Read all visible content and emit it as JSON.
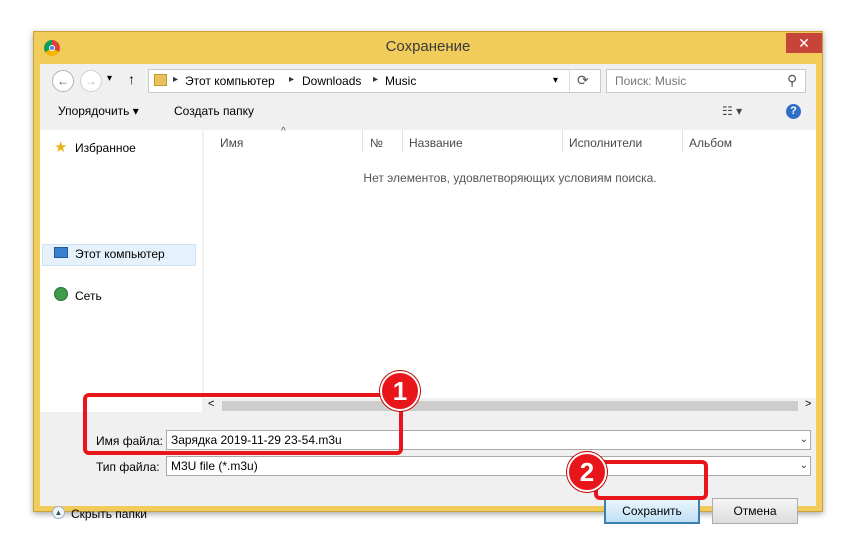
{
  "window": {
    "title": "Сохранение",
    "close_glyph": "✕"
  },
  "address": {
    "back_glyph": "←",
    "forward_glyph": "→",
    "dropdown_glyph": "▾",
    "up_glyph": "↑",
    "crumbs": [
      "Этот компьютер",
      "Downloads",
      "Music"
    ],
    "sep_glyph": "▸",
    "refresh_glyph": "⟳"
  },
  "search": {
    "placeholder": "Поиск: Music",
    "icon_glyph": "⚲"
  },
  "toolbar": {
    "organize": "Упорядочить ▾",
    "new_folder": "Создать папку",
    "view_glyph": "☷ ▾",
    "help_glyph": "?"
  },
  "nav": {
    "favorites": "Избранное",
    "computer": "Этот компьютер",
    "network": "Сеть"
  },
  "list": {
    "columns": [
      "Имя",
      "№",
      "Название",
      "Исполнители",
      "Альбом"
    ],
    "empty_message": "Нет элементов, удовлетворяющих условиям поиска.",
    "sort_glyph": "^"
  },
  "scroll": {
    "left_glyph": "<",
    "right_glyph": ">"
  },
  "form": {
    "filename_label": "Имя файла:",
    "filename_value": "Зарядка 2019-11-29 23-54.m3u",
    "filetype_label": "Тип файла:",
    "filetype_value": "M3U file (*.m3u)",
    "dd_glyph": "⌄"
  },
  "footer": {
    "hide_folders": "Скрыть папки",
    "save": "Сохранить",
    "cancel": "Отмена"
  },
  "annotations": {
    "step1": "1",
    "step2": "2"
  },
  "colors": {
    "frame": "#f1cc5b",
    "highlight": "#e8151b",
    "close": "#c7443a"
  }
}
